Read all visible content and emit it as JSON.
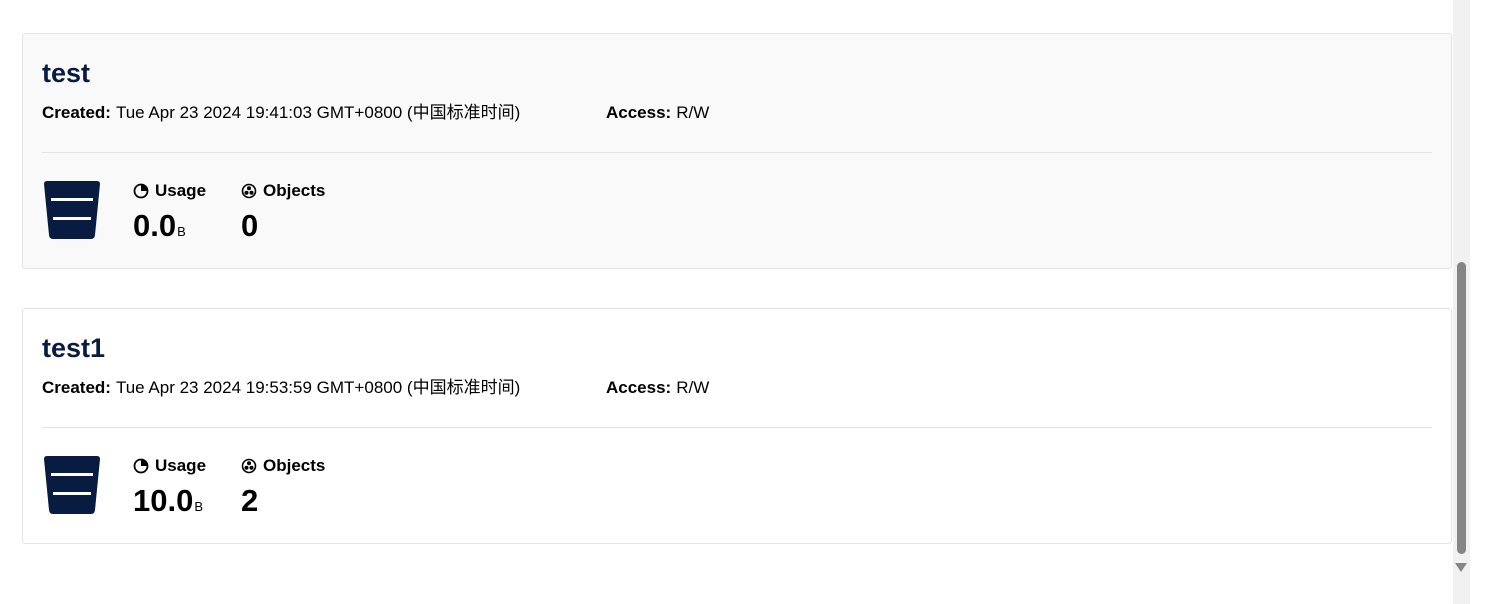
{
  "buckets": [
    {
      "name": "test",
      "created_label": "Created:",
      "created_value": "Tue Apr 23 2024 19:41:03 GMT+0800 (中国标准时间)",
      "access_label": "Access:",
      "access_value": "R/W",
      "usage_label": "Usage",
      "usage_value": "0.0",
      "usage_unit": "B",
      "objects_label": "Objects",
      "objects_value": "0",
      "icon": "bucket-icon"
    },
    {
      "name": "test1",
      "created_label": "Created:",
      "created_value": "Tue Apr 23 2024 19:53:59 GMT+0800 (中国标准时间)",
      "access_label": "Access:",
      "access_value": "R/W",
      "usage_label": "Usage",
      "usage_value": "10.0",
      "usage_unit": "B",
      "objects_label": "Objects",
      "objects_value": "2",
      "icon": "bucket-icon"
    }
  ],
  "colors": {
    "bucket_name": "#081c42",
    "bucket_icon": "#081c42",
    "card_hover_bg": "#f9f9f9",
    "card_border": "#e4e4e4",
    "scroll_thumb": "#858585"
  }
}
